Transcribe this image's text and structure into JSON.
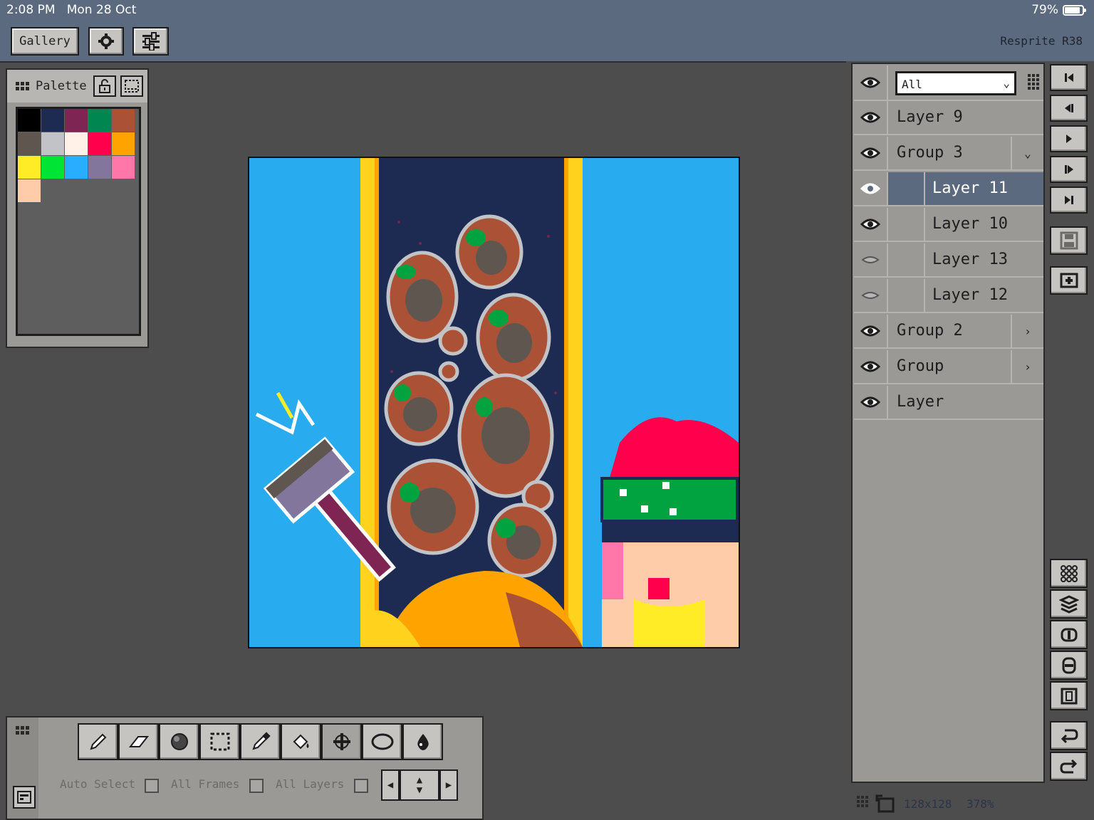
{
  "status_bar": {
    "time_date": "2:08 PM   Mon 28 Oct",
    "battery": "79%"
  },
  "toolbar": {
    "gallery_label": "Gallery",
    "app_version": "Resprite R38"
  },
  "palette": {
    "title": "Palette",
    "swatches": [
      "#000000",
      "#1d2b53",
      "#7e2553",
      "#008751",
      "#ab5236",
      "#5f574f",
      "#c2c3c7",
      "#fff1e8",
      "#ff004d",
      "#ffa300",
      "#ffec27",
      "#00e436",
      "#29adff",
      "#83769c",
      "#ff77a8",
      "#ffccaa"
    ]
  },
  "tools": {
    "auto_select_label": "Auto Select",
    "all_frames_label": "All Frames",
    "all_layers_label": "All Layers"
  },
  "layers": {
    "filter_value": "All",
    "rows": [
      {
        "name": "Layer 9"
      },
      {
        "name": "Group 3"
      },
      {
        "name": "Layer 11"
      },
      {
        "name": "Layer 10"
      },
      {
        "name": "Layer 13"
      },
      {
        "name": "Layer 12"
      },
      {
        "name": "Group 2"
      },
      {
        "name": "Group"
      },
      {
        "name": "Layer"
      }
    ],
    "canvas_size": "128x128",
    "zoom": "378%"
  }
}
